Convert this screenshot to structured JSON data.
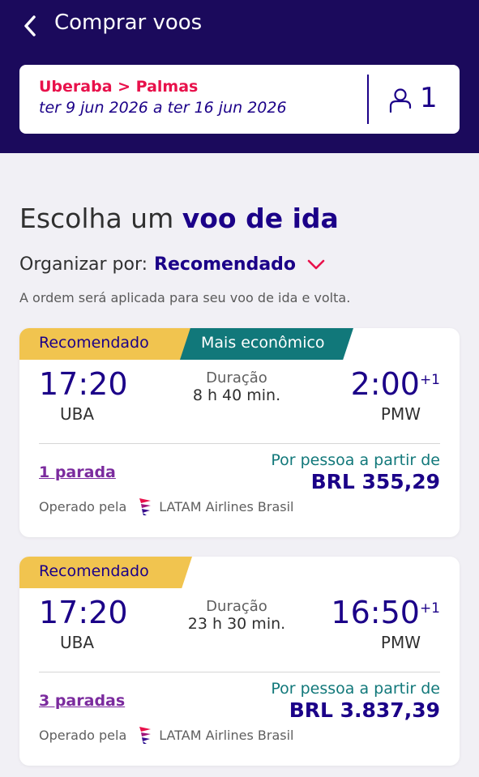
{
  "header": {
    "title": "Comprar voos",
    "route": "Uberaba > Palmas",
    "dates": "ter 9 jun 2026 a ter 16 jun 2026",
    "passengers": "1"
  },
  "section": {
    "title_prefix": "Escolha um ",
    "title_strong": "voo de ida",
    "sort_label": "Organizar por:",
    "sort_value": "Recomendado",
    "sort_note": "A ordem será aplicada para seu voo de ida e volta."
  },
  "flights": [
    {
      "badges": [
        "Recomendado",
        "Mais econômico"
      ],
      "dep_time": "17:20",
      "dep_code": "UBA",
      "duration_label": "Duração",
      "duration": "8 h 40 min.",
      "arr_time": "2:00",
      "arr_plus": "+1",
      "arr_code": "PMW",
      "stops": "1 parada",
      "price_label": "Por pessoa a partir de",
      "price": "BRL 355,29",
      "operated_label": "Operado pela",
      "airline": "LATAM Airlines Brasil"
    },
    {
      "badges": [
        "Recomendado"
      ],
      "dep_time": "17:20",
      "dep_code": "UBA",
      "duration_label": "Duração",
      "duration": "23 h 30 min.",
      "arr_time": "16:50",
      "arr_plus": "+1",
      "arr_code": "PMW",
      "stops": "3 paradas",
      "price_label": "Por pessoa a partir de",
      "price": "BRL 3.837,39",
      "operated_label": "Operado pela",
      "airline": "LATAM Airlines Brasil"
    }
  ],
  "icons": {
    "back": "chevron-left-icon",
    "passenger": "person-icon",
    "sort": "chevron-down-icon",
    "airline_logo": "latam-logo-icon"
  },
  "colors": {
    "header_bg": "#1b0a5c",
    "brand_text": "#1b0088",
    "route_red": "#e8114b",
    "badge_yellow": "#f1c44f",
    "badge_teal": "#11787a",
    "stops_purple": "#7b2b9e"
  }
}
